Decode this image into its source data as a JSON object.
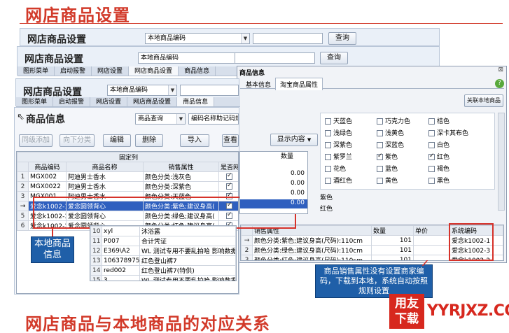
{
  "slide": {
    "title_top": "网店商品设置",
    "title_bottom": "网店商品与本地商品的对应关系"
  },
  "header": {
    "title": "网店商品设置",
    "code_combo": "本地商品编码",
    "search_button": "查询"
  },
  "tabs": {
    "a": [
      "图形菜单",
      "启动报警",
      "网店设置",
      "网店商品设置",
      "商品信息"
    ],
    "b": [
      "图形菜单",
      "启动报警",
      "网店设置",
      "网店商品设置",
      "商品信息"
    ]
  },
  "goods": {
    "title": "商品信息",
    "query_combo": "商品查询",
    "field_combo": "编码名称助记码规格型号查询",
    "toolbar": [
      "同级添加",
      "向下分类",
      "编辑",
      "删除",
      "导入",
      "查看",
      "显示内容"
    ],
    "fixed_col": "固定列",
    "columns": [
      "商品编码",
      "商品名称",
      "销售属性",
      "是否网店商品",
      "数量"
    ],
    "rows": [
      {
        "idx": "1",
        "code": "MGX002",
        "name": "阿迪男士香水",
        "attr": "颜色分类:浅灰色",
        "qty": "0.00"
      },
      {
        "idx": "2",
        "code": "MGX0022",
        "name": "阿迪男士香水",
        "attr": "颜色分类:深紫色",
        "qty": "0.00"
      },
      {
        "idx": "3",
        "code": "MGX001",
        "name": "阿迪男士香水",
        "attr": "颜色分类:天蓝色",
        "qty": "0.00"
      },
      {
        "idx": "→",
        "code": "爱念k1002-1",
        "name": "爱念圆领背心",
        "attr": "颜色分类:紫色;建议身高(",
        "qty": "0.00"
      },
      {
        "idx": "5",
        "code": "爱念k1002-3",
        "name": "爱念圆领背心",
        "attr": "颜色分类:绿色;建议身高(",
        "qty": "0.00"
      },
      {
        "idx": "6",
        "code": "爱念k1002-2",
        "name": "爱念圆领背心",
        "attr": "颜色分类:红色;建议身高(",
        "qty": "0.00"
      }
    ],
    "lower_rows": [
      {
        "idx": "10",
        "code": "xyl",
        "name": "沐浴露"
      },
      {
        "idx": "11",
        "code": "P007",
        "name": "合计凭证"
      },
      {
        "idx": "12",
        "code": "E369\\A2",
        "name": "WL 测试专用不要乱拍哈 影响数据 这个用"
      },
      {
        "idx": "13",
        "code": "10637897519",
        "name": "红色登山裤7"
      },
      {
        "idx": "14",
        "code": "red002",
        "name": "红色登山裤7(特供)"
      },
      {
        "idx": "15",
        "code": "3",
        "name": "WL 测试专用不要乱拍哈 影响数据 就不行"
      }
    ]
  },
  "dialog": {
    "title": "商品信息",
    "tabs": [
      "基本信息",
      "淘宝商品属性"
    ],
    "link_button": "关联本地商品",
    "colors": [
      {
        "label": "天蓝色",
        "checked": false
      },
      {
        "label": "巧克力色",
        "checked": false
      },
      {
        "label": "桔色",
        "checked": false
      },
      {
        "label": "浅绿色",
        "checked": false
      },
      {
        "label": "浅黄色",
        "checked": false
      },
      {
        "label": "深卡其布色",
        "checked": false
      },
      {
        "label": "深紫色",
        "checked": false
      },
      {
        "label": "深蓝色",
        "checked": false
      },
      {
        "label": "白色",
        "checked": false
      },
      {
        "label": "紫罗兰",
        "checked": false
      },
      {
        "label": "紫色",
        "checked": true
      },
      {
        "label": "红色",
        "checked": true
      },
      {
        "label": "花色",
        "checked": false
      },
      {
        "label": "蓝色",
        "checked": false
      },
      {
        "label": "褐色",
        "checked": false
      },
      {
        "label": "酒红色",
        "checked": false
      },
      {
        "label": "黄色",
        "checked": false
      },
      {
        "label": "黑色",
        "checked": false
      }
    ],
    "partial_labels": [
      "紫色",
      "红色"
    ],
    "sku_columns": [
      "销售属性",
      "数量",
      "单价",
      "系统编码"
    ],
    "sku_rows": [
      {
        "idx": "→",
        "attr": "颜色分类:紫色;建议身高(尺码):110cm",
        "qty": "101",
        "code": "爱念k1002-1"
      },
      {
        "idx": "2",
        "attr": "颜色分类:绿色;建议身高(尺码):110cm",
        "qty": "101",
        "code": "爱念k1002-3"
      },
      {
        "idx": "3",
        "attr": "颜色分类:红色;建议身高(尺码):110cm",
        "qty": "101",
        "code": "爱念k1002-2"
      }
    ]
  },
  "notes": {
    "local": "本地商品信息",
    "sku": "商品销售属性没有设置商家编码，下载到本地，系统自动按照规则设置"
  },
  "logo": {
    "badge_line1": "用友",
    "badge_line2": "下载",
    "site": "YYRJXZ.COM"
  },
  "colors": {
    "title_red": "#d23a2a",
    "selection_blue": "#2f5fbf",
    "note_blue": "#1f5fa8",
    "callout_red": "#d6322a"
  }
}
